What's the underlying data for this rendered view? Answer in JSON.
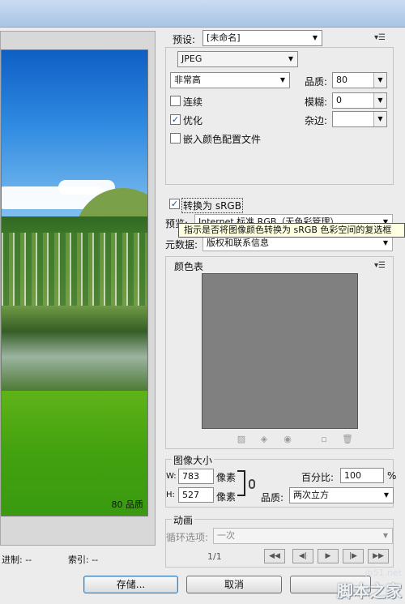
{
  "preview": {
    "quality_text": "80 品质",
    "status_left": "进制: --",
    "status_index": "索引: --"
  },
  "settings": {
    "preset_label": "预设:",
    "preset_value": "[未命名]",
    "format_value": "JPEG",
    "compression_value": "非常高",
    "quality_label": "品质:",
    "quality_value": "80",
    "progressive_label": "连续",
    "progressive_checked": false,
    "blur_label": "模糊:",
    "blur_value": "0",
    "optimized_label": "优化",
    "optimized_checked": true,
    "matte_label": "杂边:",
    "matte_value": "",
    "embed_profile_label": "嵌入颜色配置文件",
    "embed_profile_checked": false,
    "convert_srgb_label": "转换为 sRGB",
    "convert_srgb_checked": true,
    "preview_label": "预览:",
    "preview_value": "Internet 标准 RGB（无色彩管理）",
    "metadata_label": "元数据:",
    "metadata_value": "版权和联系信息"
  },
  "tooltip": {
    "text": "指示是否将图像颜色转换为 sRGB 色彩空间的复选框"
  },
  "color_table": {
    "title": "颜色表",
    "swatch_color": "#808080"
  },
  "image_size": {
    "title": "图像大小",
    "width_label": "W:",
    "width_value": "783",
    "width_unit": "像素",
    "height_label": "H:",
    "height_value": "527",
    "height_unit": "像素",
    "percent_label": "百分比:",
    "percent_value": "100",
    "percent_unit": "%",
    "quality_label": "品质:",
    "quality_value": "两次立方"
  },
  "animation": {
    "title": "动画",
    "loop_label": "循环选项:",
    "loop_value": "一次",
    "frame_counter": "1/1"
  },
  "buttons": {
    "save": "存储...",
    "cancel": "取消"
  },
  "watermark": {
    "url": "jb51.net",
    "name": "脚本之家"
  }
}
